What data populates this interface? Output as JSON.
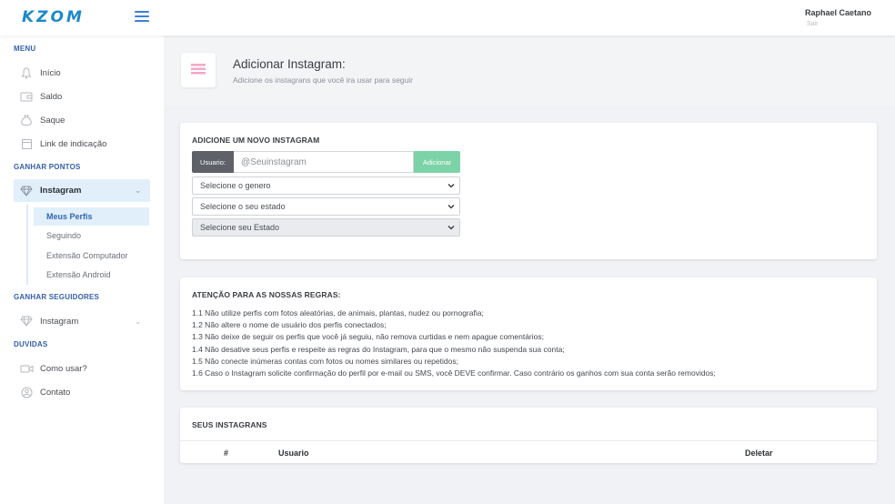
{
  "header": {
    "logo": "KZOM",
    "user_name": "Raphael Caetano",
    "logout": "Sair"
  },
  "sidebar": {
    "menu_label": "MENU",
    "menu_items": [
      {
        "label": "Início",
        "icon": "bell-icon"
      },
      {
        "label": "Saldo",
        "icon": "wallet-icon"
      },
      {
        "label": "Saque",
        "icon": "money-bag-icon"
      },
      {
        "label": "Link de indicação",
        "icon": "link-icon"
      }
    ],
    "ganhar_pontos_label": "GANHAR PONTOS",
    "instagram_label": "Instagram",
    "submenu": [
      "Meus Perfis",
      "Seguindo",
      "Extensão Computador",
      "Extensão Android"
    ],
    "ganhar_seguidores_label": "GANHAR SEGUIDORES",
    "instagram_seguidores_label": "Instagram",
    "duvidas_label": "DUVIDAS",
    "duvidas_items": [
      {
        "label": "Como usar?",
        "icon": "video-icon"
      },
      {
        "label": "Contato",
        "icon": "contact-icon"
      }
    ]
  },
  "page_header": {
    "title": "Adicionar Instagram:",
    "subtitle": "Adicione os instagrans que você ira usar para seguir"
  },
  "add_card": {
    "title": "ADICIONE UM NOVO INSTAGRAM",
    "user_label": "Usuario:",
    "user_placeholder": "@Seuinstagram",
    "add_button": "Adicionar",
    "select_gender": "Selecione o genero",
    "select_state": "Selecione o seu estado",
    "select_state2": "Selecione seu Estado"
  },
  "rules_card": {
    "title": "ATENÇÃO PARA AS NOSSAS REGRAS:",
    "rules": [
      "1.1 Não utilize perfis com fotos aleatórias, de animais, plantas, nudez ou pornografia;",
      "1.2 Não altere o nome de usuário dos perfis conectados;",
      "1.3 Não deixe de seguir os perfis que você já seguiu, não remova curtidas e nem apague comentários;",
      "1.4 Não desative seus perfis e respeite as regras do Instagram, para que o mesmo não suspenda sua conta;",
      "1.5 Não conecte inúmeras contas com fotos ou nomes similares ou repetidos;",
      "1.6 Caso o Instagram solicite confirmação do perfil por e-mail ou SMS, você DEVE confirmar. Caso contrário os ganhos com sua conta serão removidos;"
    ]
  },
  "table_card": {
    "title": "SEUS INSTAGRANS",
    "columns": [
      "#",
      "Usuario",
      "Deletar"
    ]
  },
  "colors": {
    "brand": "#1e88c9",
    "section": "#3660a8",
    "active_bg": "#e1effb",
    "add_button": "#7dd3a8"
  }
}
